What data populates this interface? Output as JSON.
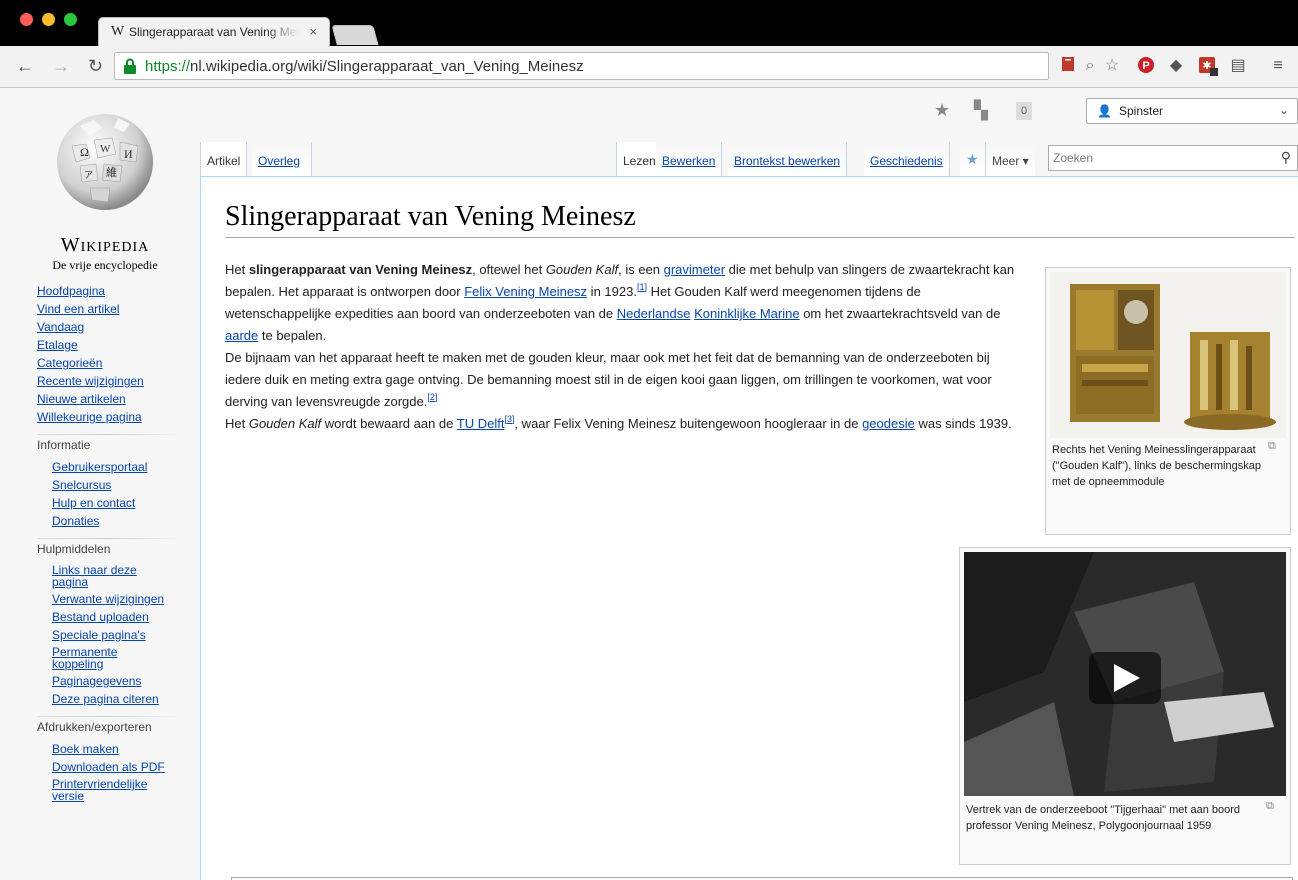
{
  "browser": {
    "tab_title": "Slingerapparaat van Vening Meinesz",
    "tab_favicon": "W",
    "tab_close": "×",
    "url_scheme": "https://",
    "url_rest": "nl.wikipedia.org/wiki/Slingerapparaat_van_Vening_Meinesz"
  },
  "logo": {
    "wordmark": "Wikipedia",
    "tagline": "De vrije encyclopedie"
  },
  "personal": {
    "username": "Spinster",
    "notification_count": "0"
  },
  "tabs": {
    "artikel": "Artikel",
    "overleg": "Overleg",
    "lezen": "Lezen",
    "bewerken": "Bewerken",
    "brontekst": "Brontekst bewerken",
    "geschiedenis": "Geschiedenis",
    "meer": "Meer",
    "search_placeholder": "Zoeken"
  },
  "sidebar": {
    "main": [
      "Hoofdpagina",
      "Vind een artikel",
      "Vandaag",
      "Etalage",
      "Categorieën",
      "Recente wijzigingen",
      "Nieuwe artikelen",
      "Willekeurige pagina"
    ],
    "info_heading": "Informatie",
    "info": [
      "Gebruikersportaal",
      "Snelcursus",
      "Hulp en contact",
      "Donaties"
    ],
    "tools_heading": "Hulpmiddelen",
    "tools": [
      "Links naar deze pagina",
      "Verwante wijzigingen",
      "Bestand uploaden",
      "Speciale pagina's",
      "Permanente koppeling",
      "Paginagegevens",
      "Deze pagina citeren"
    ],
    "print_heading": "Afdrukken/exporteren",
    "print": [
      "Boek maken",
      "Downloaden als PDF",
      "Printervriendelijke versie"
    ]
  },
  "article": {
    "title": "Slingerapparaat van Vening Meinesz",
    "p1": {
      "t1": "Het ",
      "b1": "slingerapparaat van Vening Meinesz",
      "t2": ", oftewel het ",
      "i1": "Gouden Kalf",
      "t3": ", is een ",
      "l1": "gravimeter",
      "t4": " die met behulp van slingers de zwaartekracht kan bepalen. Het apparaat is ontworpen door ",
      "l2": "Felix Vening Meinesz",
      "t5": " in 1923.",
      "ref1": "[1]",
      "t6": " Het Gouden Kalf werd meegenomen tijdens de wetenschappelijke expedities aan boord van onderzeeboten van de ",
      "l3": "Nederlandse",
      "l4": "Koninklijke Marine",
      "t7": " om het zwaartekrachtsveld van de ",
      "l5": "aarde",
      "t8": " te bepalen."
    },
    "p2": {
      "t1": "De bijnaam van het apparaat heeft te maken met de gouden kleur, maar ook met het feit dat de bemanning van de onderzeeboten bij iedere duik en meting extra gage ontving. De bemanning moest stil in de eigen kooi gaan liggen, om trillingen te voorkomen, wat voor derving van levensvreugde zorgde.",
      "ref2": "[2]"
    },
    "p3": {
      "t1": "Het ",
      "i1": "Gouden Kalf",
      "t2": " wordt bewaard aan de ",
      "l1": "TU Delft",
      "ref3": "[3]",
      "t3": ", waar Felix Vening Meinesz buitengewoon hoogleraar in de ",
      "l2": "geodesie",
      "t4": " was sinds 1939."
    },
    "figure1_caption": "Rechts het Vening Meinesslingerapparaat (\"Gouden Kalf\"), links de beschermingskap met de opneemmodule",
    "figure2_caption": "Vertrek van de onderzeeboot \"Tijgerhaai\" met aan boord professor Vening Meinesz, Polygoonjournaal 1959"
  }
}
